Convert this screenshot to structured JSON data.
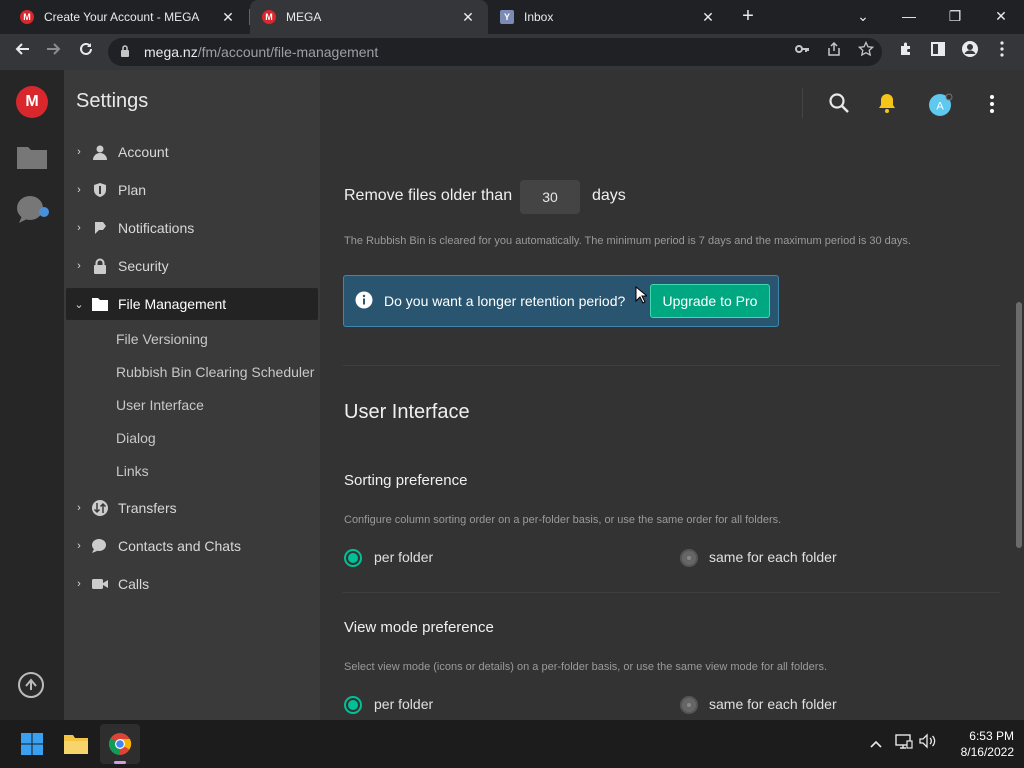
{
  "browser": {
    "tabs": [
      {
        "title": "Create Your Account - MEGA",
        "icon": "mega-favicon",
        "active": false
      },
      {
        "title": "MEGA",
        "icon": "mega-favicon",
        "active": true
      },
      {
        "title": "Inbox",
        "icon": "yahoo-favicon",
        "active": false
      }
    ],
    "tab_close": "✕",
    "new_tab": "+",
    "window_controls": {
      "list": "⌄",
      "minimize": "—",
      "maximize": "❐",
      "close": "✕"
    },
    "url_host": "mega.nz",
    "url_path": "/fm/account/file-management"
  },
  "app": {
    "logo_letter": "M",
    "settings_title": "Settings",
    "nav": [
      {
        "label": "Account",
        "icon": "user-icon"
      },
      {
        "label": "Plan",
        "icon": "shield-icon"
      },
      {
        "label": "Notifications",
        "icon": "notification-icon"
      },
      {
        "label": "Security",
        "icon": "lock-icon"
      },
      {
        "label": "File Management",
        "icon": "folder-icon",
        "active": true
      },
      {
        "label": "Transfers",
        "icon": "transfers-icon"
      },
      {
        "label": "Contacts and Chats",
        "icon": "chat-icon"
      },
      {
        "label": "Calls",
        "icon": "video-icon"
      }
    ],
    "sub_nav": [
      "File Versioning",
      "Rubbish Bin Clearing Scheduler",
      "User Interface",
      "Dialog",
      "Links"
    ],
    "header": {
      "avatar_letter": "A"
    },
    "rubbish": {
      "label_before": "Remove files older than",
      "days_value": "30",
      "label_after": "days",
      "description": "The Rubbish Bin is cleared for you automatically. The minimum period is 7 days and the maximum period is 30 days."
    },
    "banner": {
      "text": "Do you want a longer retention period?",
      "button": "Upgrade to Pro"
    },
    "ui_section": {
      "title": "User Interface",
      "sorting": {
        "title": "Sorting preference",
        "description": "Configure column sorting order on a per-folder basis, or use the same order for all folders.",
        "option_a": "per folder",
        "option_b": "same for each folder",
        "selected": "per folder"
      },
      "view_mode": {
        "title": "View mode preference",
        "description": "Select view mode (icons or details) on a per-folder basis, or use the same view mode for all folders.",
        "option_a": "per folder",
        "option_b": "same for each folder",
        "selected": "per folder"
      }
    },
    "colors": {
      "accent": "#00c297",
      "brand": "#d9272e",
      "banner_bg": "#2a5570"
    }
  },
  "taskbar": {
    "time": "6:53 PM",
    "date": "8/16/2022"
  }
}
